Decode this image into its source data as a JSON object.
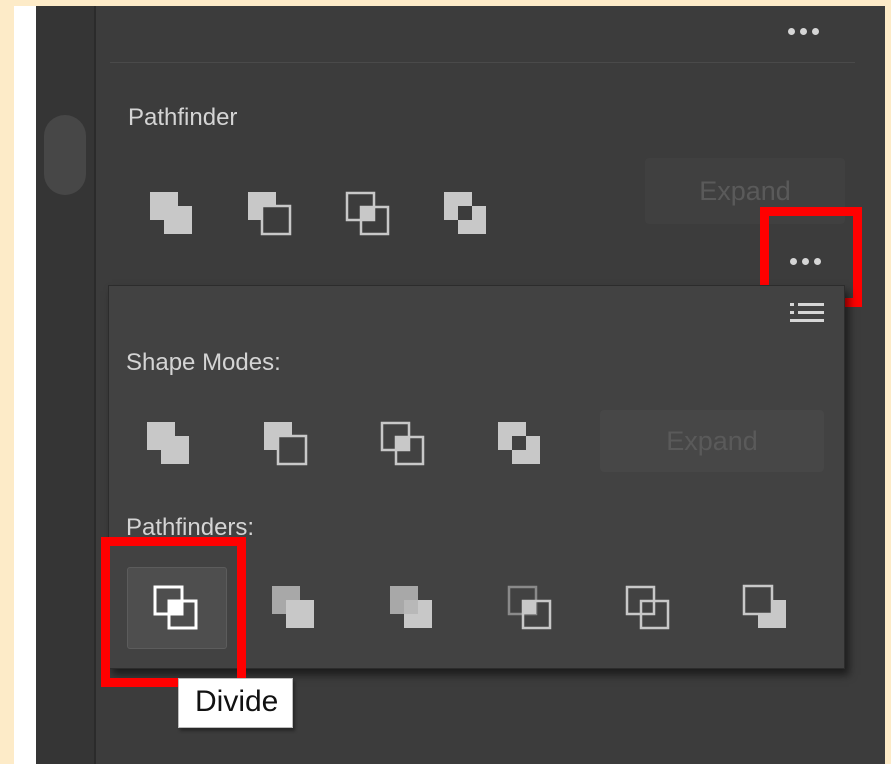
{
  "panel": {
    "title": "Pathfinder",
    "expand_label": "Expand"
  },
  "flyout": {
    "shape_modes_label": "Shape Modes:",
    "pathfinders_label": "Pathfinders:",
    "expand_label": "Expand"
  },
  "tooltip": {
    "text": "Divide"
  },
  "icons": {
    "shape_modes": [
      "unite-icon",
      "minus-front-icon",
      "intersect-icon",
      "exclude-icon"
    ],
    "pathfinders": [
      "divide-icon",
      "trim-icon",
      "merge-icon",
      "crop-icon",
      "outline-icon",
      "minus-back-icon"
    ],
    "menu": [
      "more-options-icon",
      "panel-menu-icon"
    ]
  },
  "colors": {
    "panel_bg": "#3c3c3c",
    "icon_fill": "#c8c8c8",
    "highlight": "#ff0000",
    "page_bg": "#fdebc8"
  }
}
